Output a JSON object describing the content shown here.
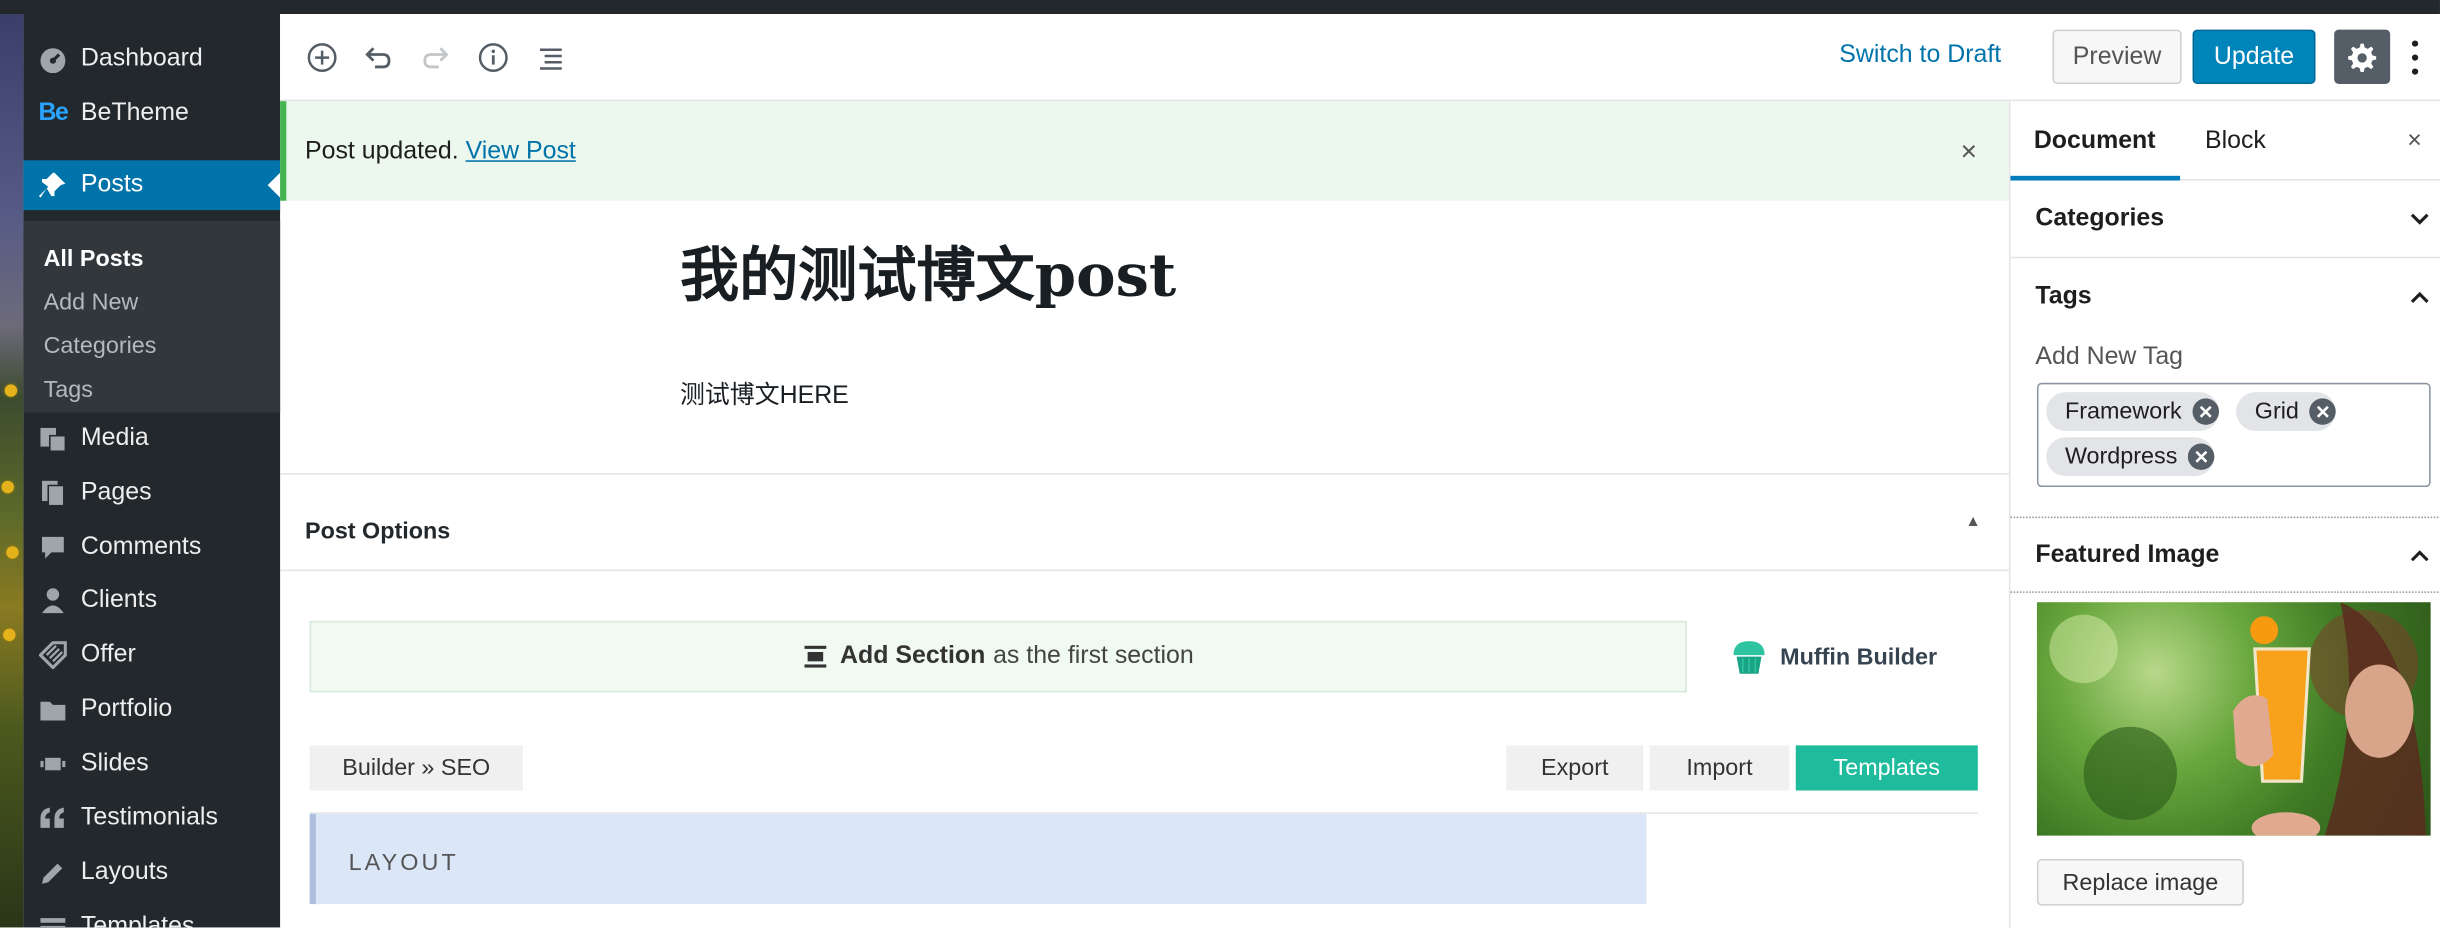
{
  "sidebar": {
    "top_items": [
      {
        "label": "Dashboard",
        "icon": "dashboard-icon"
      },
      {
        "label": "BeTheme",
        "icon": "betheme-logo"
      }
    ],
    "posts": {
      "label": "Posts",
      "icon": "pin-icon"
    },
    "sub_items": [
      {
        "label": "All Posts"
      },
      {
        "label": "Add New"
      },
      {
        "label": "Categories"
      },
      {
        "label": "Tags"
      }
    ],
    "items": [
      {
        "label": "Media",
        "icon": "media-icon"
      },
      {
        "label": "Pages",
        "icon": "pages-icon"
      },
      {
        "label": "Comments",
        "icon": "comments-icon"
      },
      {
        "label": "Clients",
        "icon": "clients-icon"
      },
      {
        "label": "Offer",
        "icon": "offer-icon"
      },
      {
        "label": "Portfolio",
        "icon": "portfolio-icon"
      },
      {
        "label": "Slides",
        "icon": "slides-icon"
      },
      {
        "label": "Testimonials",
        "icon": "testimonials-icon"
      },
      {
        "label": "Layouts",
        "icon": "layouts-icon"
      },
      {
        "label": "Templates",
        "icon": "templates-icon"
      }
    ],
    "betheme_logo_text": "Be"
  },
  "toolbar": {
    "switch_draft": "Switch to Draft",
    "preview": "Preview",
    "update": "Update"
  },
  "notice": {
    "text": "Post updated. ",
    "link": "View Post",
    "close": "×"
  },
  "editor": {
    "title": "我的测试博文post",
    "body": "测试博文HERE"
  },
  "post_options": {
    "title": "Post Options",
    "add_section_bold": "Add Section",
    "add_section_rest": "as the first section",
    "muffin_builder": "Muffin Builder",
    "builder_seo": "Builder » SEO",
    "export": "Export",
    "import": "Import",
    "templates": "Templates",
    "layout": "LAYOUT"
  },
  "panel": {
    "tab_document": "Document",
    "tab_block": "Block",
    "close": "×",
    "categories": "Categories",
    "tags": "Tags",
    "add_new_tag": "Add New Tag",
    "tag_list": [
      "Framework",
      "Grid",
      "Wordpress"
    ],
    "featured_image": "Featured Image",
    "replace_image": "Replace image"
  },
  "colors": {
    "accent": "#0073aa",
    "update_button": "#0085ba",
    "templates_button": "#1ebc9c",
    "notice_border": "#46b450"
  }
}
